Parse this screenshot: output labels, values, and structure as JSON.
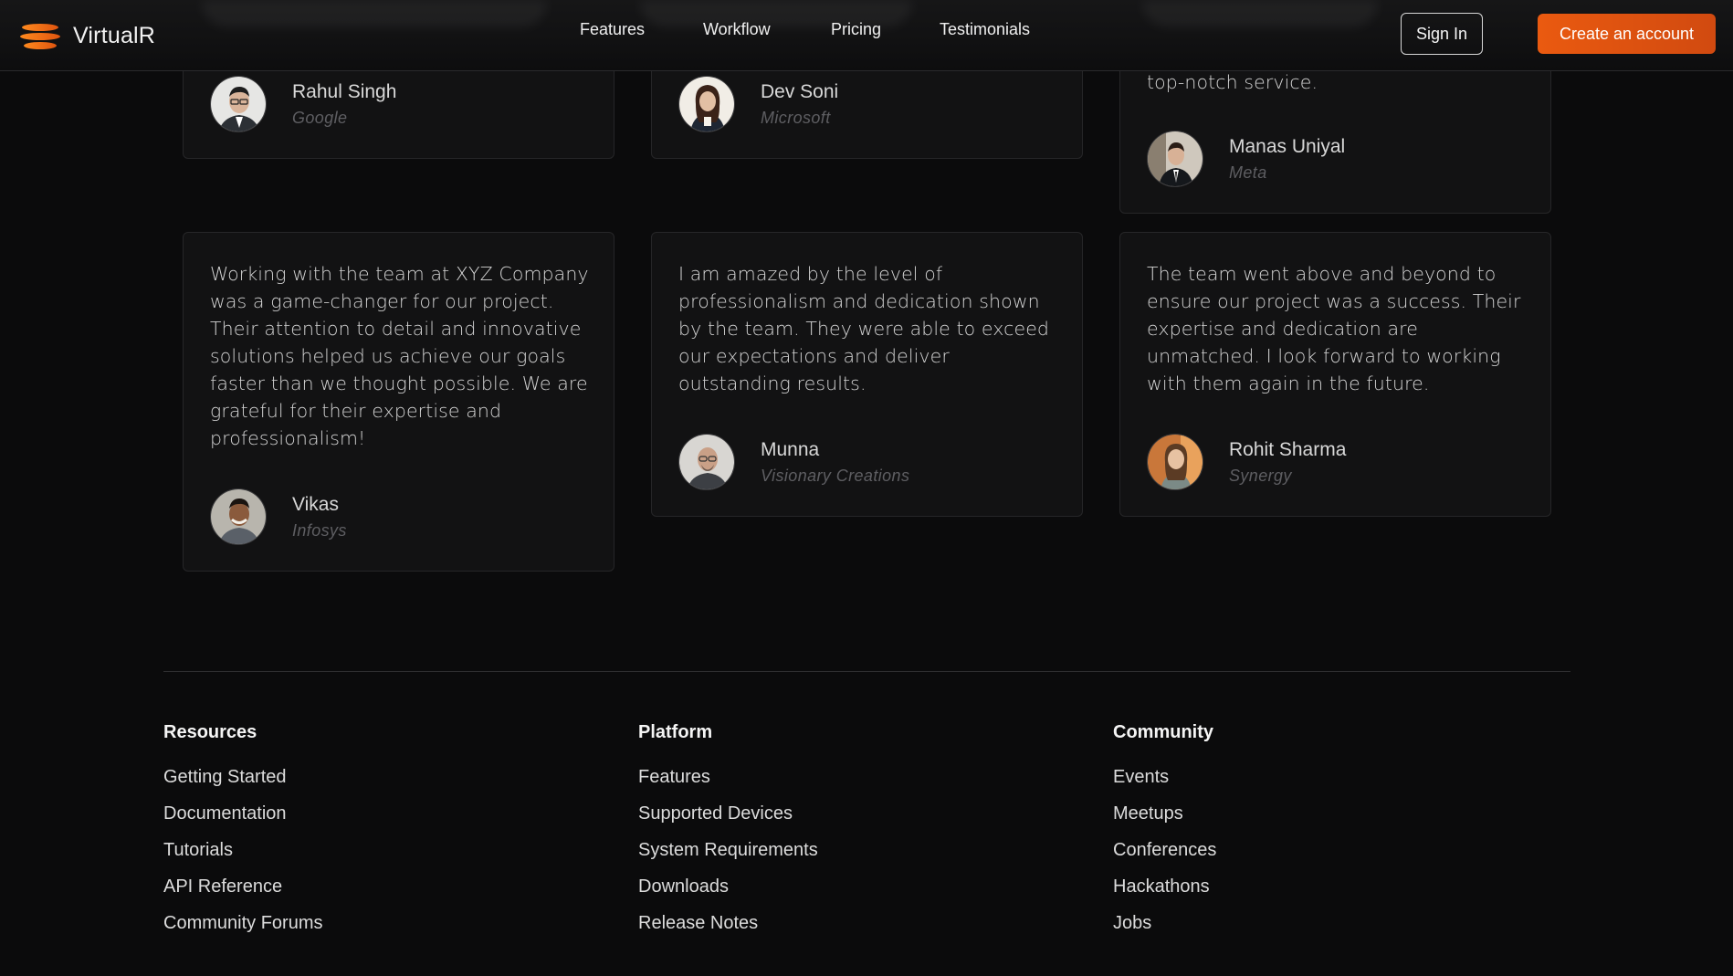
{
  "header": {
    "brand": "VirtualR",
    "nav": [
      "Features",
      "Workflow",
      "Pricing",
      "Testimonials"
    ],
    "sign_in": "Sign In",
    "create_account": "Create an account"
  },
  "testimonials": {
    "top_row": [
      {
        "name": "Rahul Singh",
        "company": "Google"
      },
      {
        "name": "Dev Soni",
        "company": "Microsoft"
      },
      {
        "quote_tail": "top-notch service.",
        "name": "Manas Uniyal",
        "company": "Meta"
      }
    ],
    "bottom_row": [
      {
        "quote": "Working with the team at XYZ Company was a game-changer for our project. Their attention to detail and innovative solutions helped us achieve our goals faster than we thought possible. We are grateful for their expertise and professionalism!",
        "name": "Vikas",
        "company": "Infosys"
      },
      {
        "quote": "I am amazed by the level of professionalism and dedication shown by the team. They were able to exceed our expectations and deliver outstanding results.",
        "name": "Munna",
        "company": "Visionary Creations"
      },
      {
        "quote": "The team went above and beyond to ensure our project was a success. Their expertise and dedication are unmatched. I look forward to working with them again in the future.",
        "name": "Rohit Sharma",
        "company": "Synergy"
      }
    ]
  },
  "footer": {
    "columns": [
      {
        "title": "Resources",
        "links": [
          "Getting Started",
          "Documentation",
          "Tutorials",
          "API Reference",
          "Community Forums"
        ]
      },
      {
        "title": "Platform",
        "links": [
          "Features",
          "Supported Devices",
          "System Requirements",
          "Downloads",
          "Release Notes"
        ]
      },
      {
        "title": "Community",
        "links": [
          "Events",
          "Meetups",
          "Conferences",
          "Hackathons",
          "Jobs"
        ]
      }
    ]
  },
  "colors": {
    "background": "#0b0b0c",
    "card": "#121213",
    "accent": "#ea5a10",
    "muted_text": "#5e5e62"
  }
}
